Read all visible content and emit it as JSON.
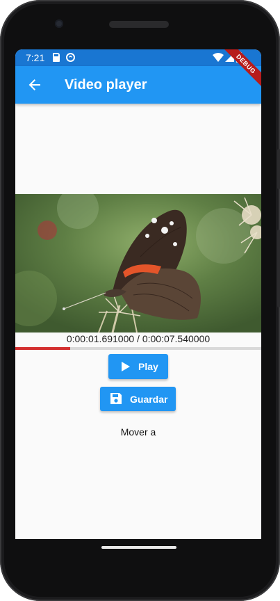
{
  "status_bar": {
    "time": "7:21",
    "icons": [
      "sd-card-icon",
      "sync-circle-icon",
      "wifi-icon",
      "signal-icon",
      "battery-icon"
    ]
  },
  "app_bar": {
    "title": "Video player",
    "back_icon": "arrow-back-icon",
    "color": "#2196f3"
  },
  "debug_banner": {
    "label": "DEBUG",
    "color": "#b71c1c"
  },
  "video": {
    "position_text": "0:00:01.691000 / 0:00:07.540000",
    "progress_fraction": 0.224
  },
  "controls": {
    "play_label": "Play",
    "play_icon": "play-icon",
    "save_label": "Guardar",
    "save_icon": "save-icon",
    "seek_label": "Mover a"
  },
  "colors": {
    "accent": "#2196f3",
    "status_bar": "#1976d2",
    "progress": "#d32f2f"
  }
}
